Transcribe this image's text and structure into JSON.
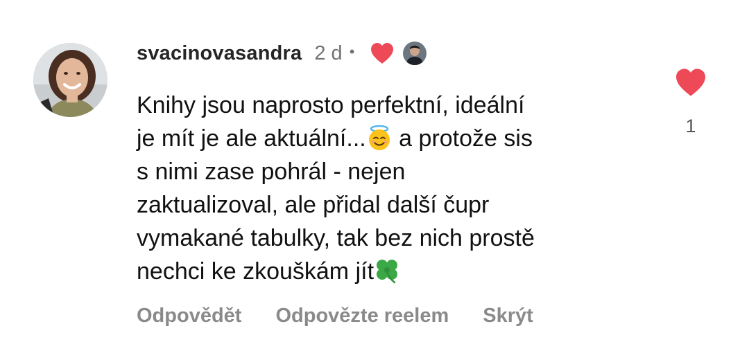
{
  "comment": {
    "username": "svacinovasandra",
    "timestamp": "2 d",
    "separator": "•",
    "author_liked": true,
    "text_segments": {
      "part1": "Knihy jsou naprosto perfektní, ideální\nje mít je ale aktuální...",
      "emoji1": "smiling-face-with-halo",
      "part2": " a protože sis\ns nimi zase pohrál - nejen\nzaktualizoval, ale přidal další čupr\nvymakané tabulky, tak bez nich prostě\nnechci ke zkouškám jít",
      "emoji2": "four-leaf-clover"
    },
    "like_count": "1",
    "actions": {
      "reply": "Odpovědět",
      "reply_reel": "Odpovězte reelem",
      "hide": "Skrýt"
    }
  },
  "colors": {
    "heart": "#ed4956",
    "muted_text": "#8a8a8a",
    "username": "#262626"
  }
}
